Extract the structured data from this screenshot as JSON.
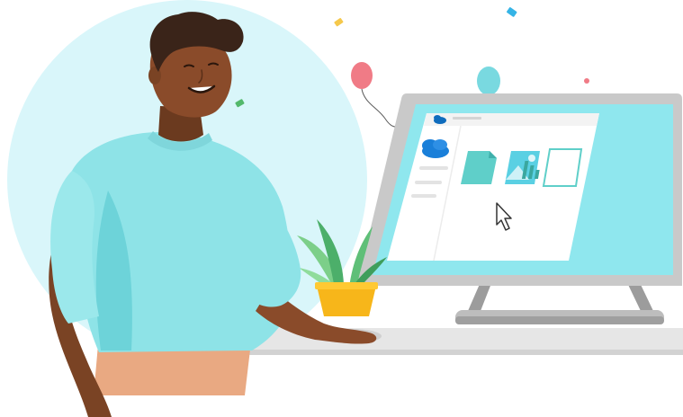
{
  "illustration": {
    "subject": "person-at-computer",
    "icons": [
      "onedrive-cloud-icon",
      "document-icon",
      "image-icon",
      "chart-icon",
      "mouse-cursor-icon"
    ],
    "decorations": [
      "balloon-icon",
      "confetti-icon",
      "plant-icon"
    ]
  },
  "colors": {
    "background_circle": "#d9f6fa",
    "sweater": "#8ee3e7",
    "sweater_shadow": "#52c7cd",
    "skin": "#8a4b2a",
    "skin_shadow": "#6b3a1f",
    "hair": "#3a2419",
    "pants": "#e9a982",
    "monitor_frame": "#bfbfbf",
    "monitor_screen": "#8fe7ee",
    "desk": "#e6e6e6",
    "pot": "#f7b61a",
    "leaves": "#4caf6a",
    "onedrive_blue": "#0f6cbd",
    "balloon_pink": "#f07b86",
    "balloon_cyan": "#79d9e0",
    "confetti_yellow": "#f5c84b",
    "confetti_blue": "#35b4e6",
    "confetti_green": "#53b86b"
  }
}
